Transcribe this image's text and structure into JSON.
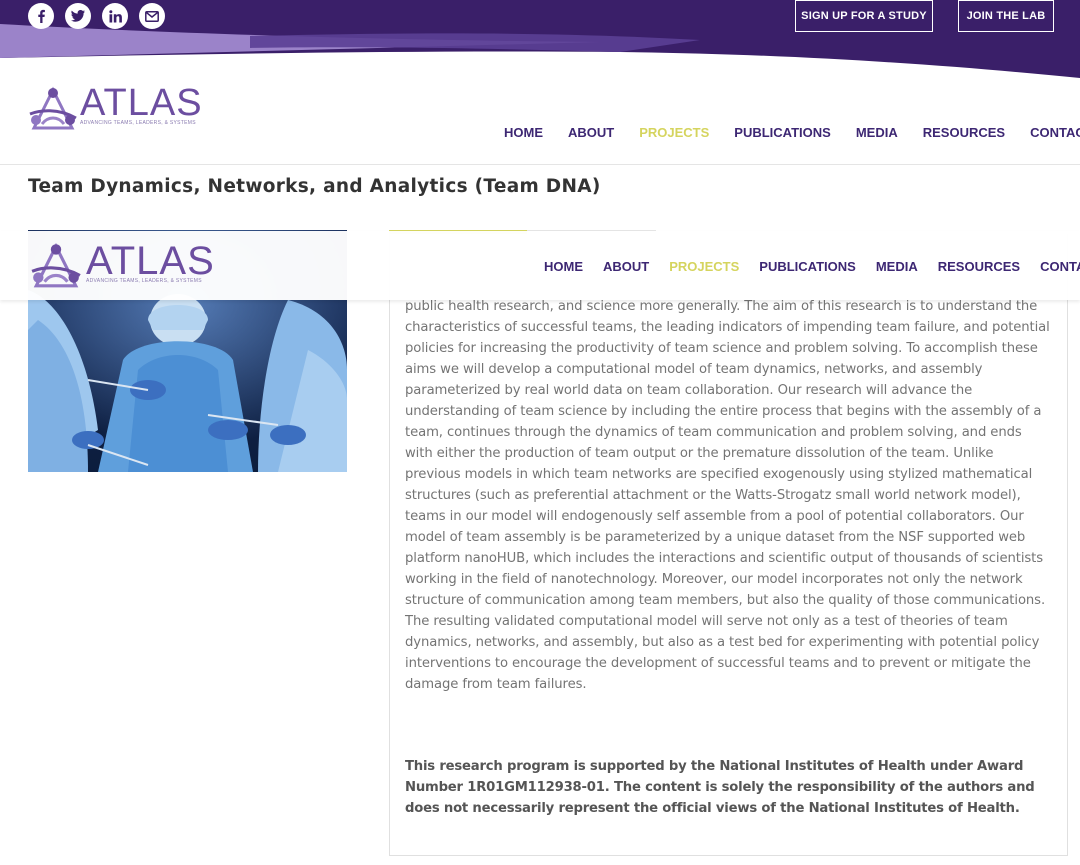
{
  "social": [
    {
      "name": "facebook-icon",
      "glyph": "f"
    },
    {
      "name": "twitter-icon",
      "glyph": "t"
    },
    {
      "name": "linkedin-icon",
      "glyph": "in"
    },
    {
      "name": "email-icon",
      "glyph": "mail"
    }
  ],
  "top_buttons": {
    "signup": "SIGN UP FOR A STUDY",
    "join": "JOIN THE LAB"
  },
  "logo": {
    "word": "ATLAS",
    "tagline": "ADVANCING TEAMS, LEADERS, & SYSTEMS"
  },
  "nav": {
    "items": [
      "HOME",
      "ABOUT",
      "PROJECTS",
      "PUBLICATIONS",
      "MEDIA",
      "RESOURCES",
      "CONTACT"
    ],
    "active": "PROJECTS"
  },
  "page_title": "Team Dynamics, Networks, and Analytics (Team DNA)",
  "body_text": "public health research, and science more generally. The aim of this research is to understand the characteristics of successful teams, the leading indicators of impending team failure, and potential policies for increasing the productivity of team science and problem solving. To accomplish these aims we will develop a computational model of team dynamics, networks, and assembly parameterized by real world data on team collaboration. Our research will advance the understanding of team science by including the entire process that begins with the assembly of a team, continues through the dynamics of team communication and problem solving, and ends with either the production of team output or the premature dissolution of the team. Unlike previous models in which team networks are specified exogenously using stylized mathematical structures (such as preferential attachment or the Watts-Strogatz small world network model), teams in our model will endogenously self assemble from a pool of potential collaborators. Our model of team assembly is be parameterized by a unique dataset from the NSF supported web platform nanoHUB, which includes the interactions and scientific output of thousands of scientists working in the field of nanotechnology. Moreover, our model incorporates not only the network structure of communication among team members, but also the quality of those communications. The resulting validated computational model will serve not only as a test of theories of team dynamics, networks, and assembly, but also as a test bed for experimenting with potential policy interventions to encourage the development of successful teams and to prevent or mitigate the damage from team failures.",
  "support_text": "This research program is supported by the National Institutes of Health under Award Number 1R01GM112938-01. The content is solely the responsibility of the authors and does not necessarily represent the official views of the National Institutes of Health.",
  "colors": {
    "brand_purple": "#3d2773",
    "light_purple": "#8f76c2",
    "accent_yellow": "#d5d45e",
    "logo_purple": "#6c4ea0"
  }
}
